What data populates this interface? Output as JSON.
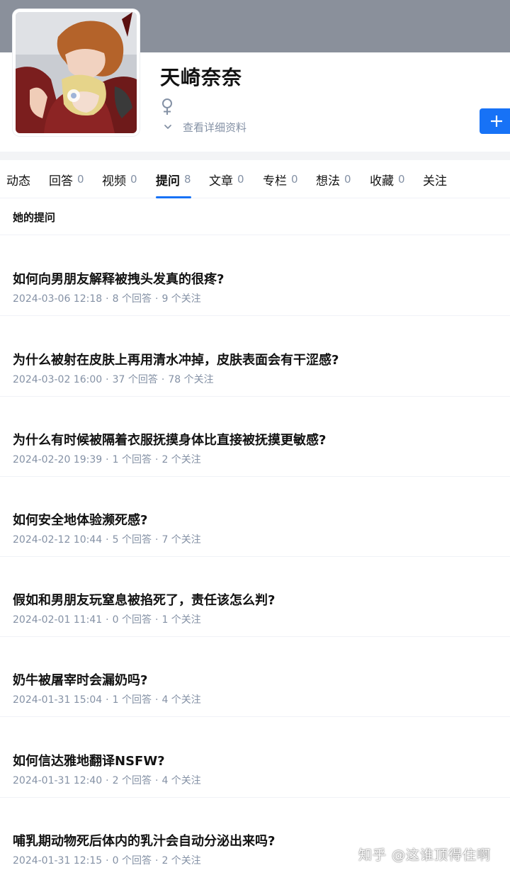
{
  "profile": {
    "name": "天崎奈奈",
    "gender_icon": "female-icon",
    "detail_link": "查看详细资料",
    "follow_icon": "plus-icon"
  },
  "colors": {
    "accent": "#1772f6",
    "cover": "#8a909b",
    "meta": "#8491a5"
  },
  "tabs": [
    {
      "label": "动态",
      "count": ""
    },
    {
      "label": "回答",
      "count": "0"
    },
    {
      "label": "视频",
      "count": "0"
    },
    {
      "label": "提问",
      "count": "8",
      "active": true
    },
    {
      "label": "文章",
      "count": "0"
    },
    {
      "label": "专栏",
      "count": "0"
    },
    {
      "label": "想法",
      "count": "0"
    },
    {
      "label": "收藏",
      "count": "0"
    },
    {
      "label": "关注",
      "count": ""
    }
  ],
  "section": {
    "title": "她的提问"
  },
  "questions": [
    {
      "title": "如何向男朋友解释被拽头发真的很疼?",
      "date": "2024-03-06 12:18",
      "answers": "8 个回答",
      "followers": "9 个关注"
    },
    {
      "title": "为什么被射在皮肤上再用清水冲掉，皮肤表面会有干涩感?",
      "date": "2024-03-02 16:00",
      "answers": "37 个回答",
      "followers": "78 个关注"
    },
    {
      "title": "为什么有时候被隔着衣服抚摸身体比直接被抚摸更敏感?",
      "date": "2024-02-20 19:39",
      "answers": "1 个回答",
      "followers": "2 个关注"
    },
    {
      "title": "如何安全地体验濒死感?",
      "date": "2024-02-12 10:44",
      "answers": "5 个回答",
      "followers": "7 个关注"
    },
    {
      "title": "假如和男朋友玩窒息被掐死了，责任该怎么判?",
      "date": "2024-02-01 11:41",
      "answers": "0 个回答",
      "followers": "1 个关注"
    },
    {
      "title": "奶牛被屠宰时会漏奶吗?",
      "date": "2024-01-31 15:04",
      "answers": "1 个回答",
      "followers": "4 个关注"
    },
    {
      "title": "如何信达雅地翻译NSFW?",
      "date": "2024-01-31 12:40",
      "answers": "2 个回答",
      "followers": "4 个关注"
    },
    {
      "title": "哺乳期动物死后体内的乳汁会自动分泌出来吗?",
      "date": "2024-01-31 12:15",
      "answers": "0 个回答",
      "followers": "2 个关注"
    }
  ],
  "watermark": "知乎 @这谁顶得住啊"
}
